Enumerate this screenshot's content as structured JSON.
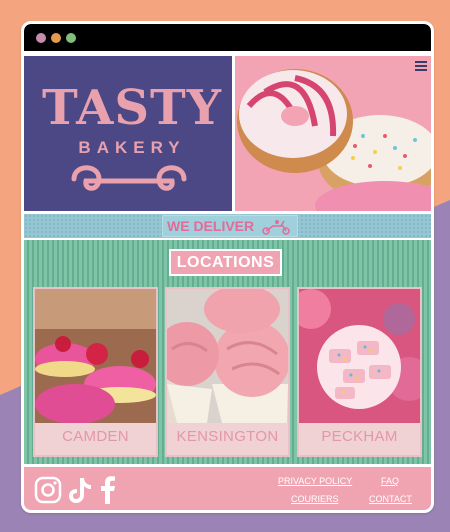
{
  "window": {
    "controls": [
      "close",
      "minimize",
      "maximize"
    ]
  },
  "brand": {
    "name": "TASTY",
    "tagline": "BAKERY",
    "primary_color": "#4c4785",
    "accent_color": "#e8a1ad"
  },
  "header": {
    "menu_icon": "hamburger-menu-icon",
    "hero_image": "donuts-photo"
  },
  "delivery": {
    "label": "WE DELIVER",
    "icon": "scooter-icon"
  },
  "locations": {
    "title": "LOCATIONS",
    "items": [
      {
        "label": "CAMDEN",
        "image": "macarons-photo"
      },
      {
        "label": "KENSINGTON",
        "image": "cupcakes-photo"
      },
      {
        "label": "PECKHAM",
        "image": "sprinkle-cookies-photo"
      }
    ]
  },
  "footer": {
    "social": [
      "instagram-icon",
      "tiktok-icon",
      "facebook-icon"
    ],
    "links": {
      "privacy": "PRIVACY POLICY",
      "faq": "FAQ",
      "couriers": "COURIERS",
      "contact": "CONTACT"
    }
  }
}
